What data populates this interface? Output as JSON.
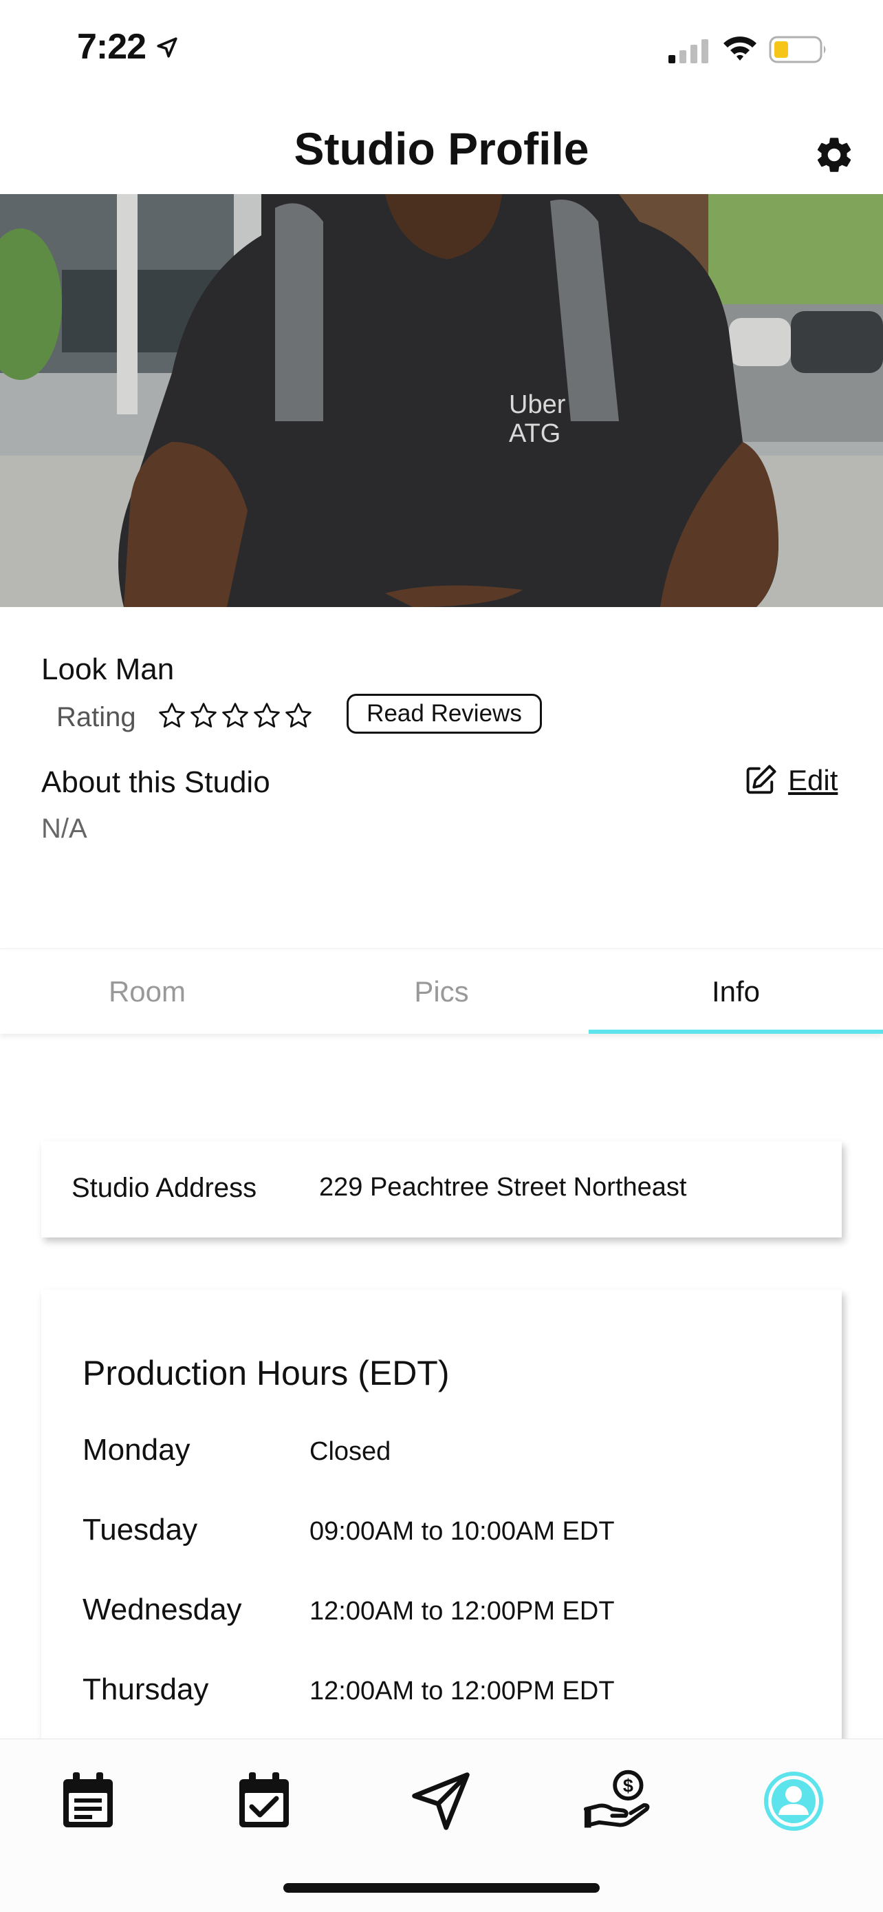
{
  "status_bar": {
    "time": "7:22",
    "icons": [
      "location-arrow-icon",
      "cellular-signal-icon",
      "wifi-icon",
      "battery-low-icon"
    ],
    "battery_color": "#f5c518"
  },
  "header": {
    "title": "Studio Profile",
    "settings_icon": "gear-icon"
  },
  "profile": {
    "name": "Look Man",
    "rating_label": "Rating",
    "rating_value": 0,
    "rating_max": 5,
    "read_reviews_label": "Read Reviews",
    "about_title": "About this Studio",
    "about_text": "N/A",
    "edit_label": "Edit"
  },
  "tabs": [
    {
      "label": "Room",
      "active": false
    },
    {
      "label": "Pics",
      "active": false
    },
    {
      "label": "Info",
      "active": true
    }
  ],
  "accent_color": "#5de3ec",
  "address": {
    "label": "Studio Address",
    "value": "229 Peachtree Street Northeast"
  },
  "hours": {
    "title": "Production Hours (EDT)",
    "rows": [
      {
        "day": "Monday",
        "time": "Closed"
      },
      {
        "day": "Tuesday",
        "time": "09:00AM to 10:00AM EDT"
      },
      {
        "day": "Wednesday",
        "time": "12:00AM to 12:00PM EDT"
      },
      {
        "day": "Thursday",
        "time": "12:00AM to 12:00PM EDT"
      }
    ]
  },
  "bottom_nav": [
    {
      "icon": "calendar-list-icon",
      "active": false
    },
    {
      "icon": "calendar-check-icon",
      "active": false
    },
    {
      "icon": "paper-plane-icon",
      "active": false
    },
    {
      "icon": "hand-money-icon",
      "active": false
    },
    {
      "icon": "profile-avatar-icon",
      "active": true
    }
  ]
}
